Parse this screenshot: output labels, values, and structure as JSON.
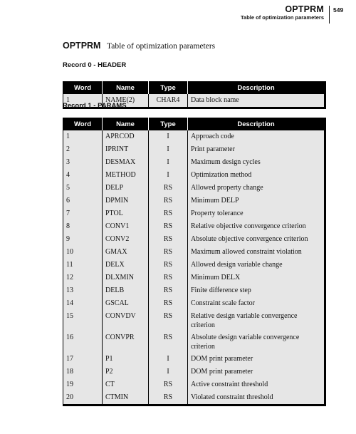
{
  "running_head": {
    "title": "OPTPRM",
    "subtitle": "Table of optimization parameters",
    "page_number": "549"
  },
  "doc": {
    "code": "OPTPRM",
    "description": "Table of optimization parameters"
  },
  "columns": [
    "Word",
    "Name",
    "Type",
    "Description"
  ],
  "records": [
    {
      "heading": "Record 0 - HEADER",
      "rows": [
        {
          "word": "1",
          "name": "NAME(2)",
          "type": "CHAR4",
          "description": "Data block name"
        }
      ]
    },
    {
      "heading": "Record 1 - PARAMS",
      "rows": [
        {
          "word": "1",
          "name": "APRCOD",
          "type": "I",
          "description": "Approach code"
        },
        {
          "word": "2",
          "name": "IPRINT",
          "type": "I",
          "description": "Print parameter"
        },
        {
          "word": "3",
          "name": "DESMAX",
          "type": "I",
          "description": "Maximum design cycles"
        },
        {
          "word": "4",
          "name": "METHOD",
          "type": "I",
          "description": "Optimization method"
        },
        {
          "word": "5",
          "name": "DELP",
          "type": "RS",
          "description": "Allowed property change"
        },
        {
          "word": "6",
          "name": "DPMIN",
          "type": "RS",
          "description": "Minimum DELP"
        },
        {
          "word": "7",
          "name": "PTOL",
          "type": "RS",
          "description": "Property tolerance"
        },
        {
          "word": "8",
          "name": "CONV1",
          "type": "RS",
          "description": "Relative objective convergence criterion"
        },
        {
          "word": "9",
          "name": "CONV2",
          "type": "RS",
          "description": "Absolute objective convergence criterion"
        },
        {
          "word": "10",
          "name": "GMAX",
          "type": "RS",
          "description": "Maximum allowed constraint violation"
        },
        {
          "word": "11",
          "name": "DELX",
          "type": "RS",
          "description": "Allowed design variable change"
        },
        {
          "word": "12",
          "name": "DLXMIN",
          "type": "RS",
          "description": "Minimum DELX"
        },
        {
          "word": "13",
          "name": "DELB",
          "type": "RS",
          "description": "Finite difference step"
        },
        {
          "word": "14",
          "name": "GSCAL",
          "type": "RS",
          "description": "Constraint scale factor"
        },
        {
          "word": "15",
          "name": "CONVDV",
          "type": "RS",
          "description": "Relative design variable convergence criterion"
        },
        {
          "word": "16",
          "name": "CONVPR",
          "type": "RS",
          "description": "Absolute design variable convergence criterion"
        },
        {
          "word": "17",
          "name": "P1",
          "type": "I",
          "description": "DOM print parameter"
        },
        {
          "word": "18",
          "name": "P2",
          "type": "I",
          "description": "DOM print parameter"
        },
        {
          "word": "19",
          "name": "CT",
          "type": "RS",
          "description": "Active constraint threshold"
        },
        {
          "word": "20",
          "name": "CTMIN",
          "type": "RS",
          "description": "Violated constraint threshold"
        }
      ]
    }
  ]
}
